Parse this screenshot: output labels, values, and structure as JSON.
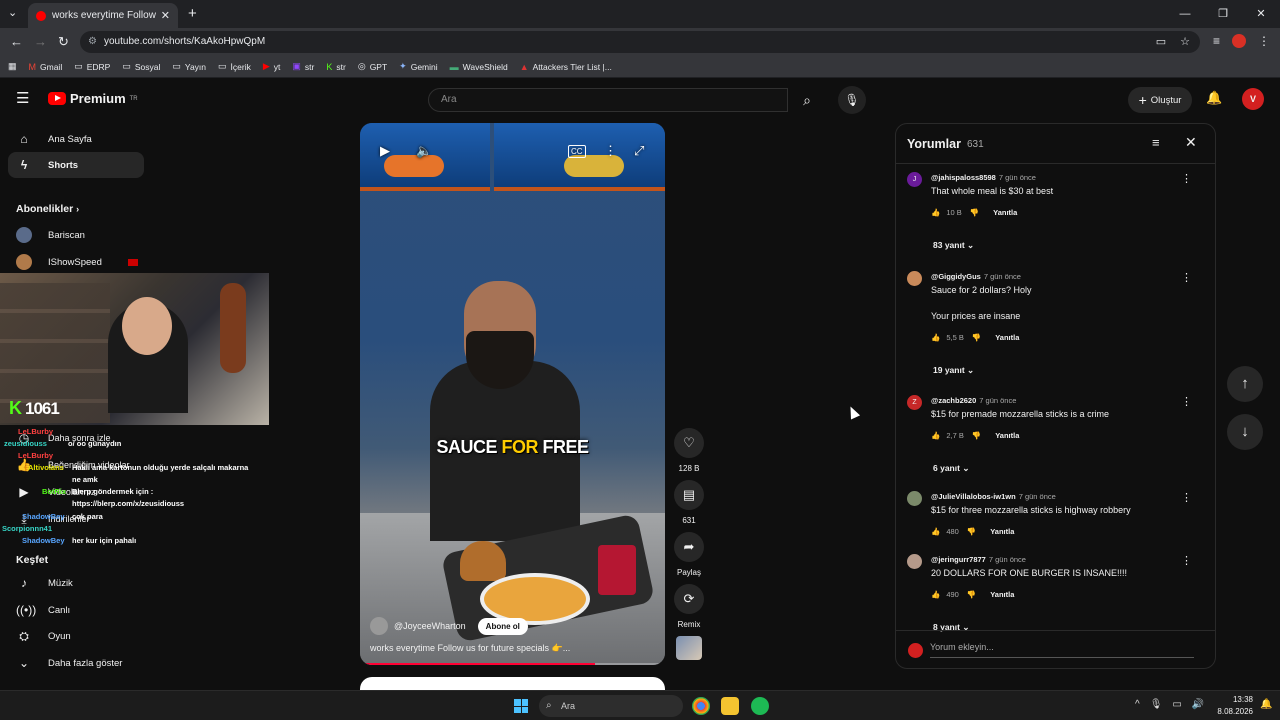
{
  "browser": {
    "tab_title": "works everytime Follow us for fu",
    "url": "youtube.com/shorts/KaAkoHpwQpM",
    "bookmarks": [
      "Gmail",
      "EDRP",
      "Sosyal",
      "Yayın",
      "İçerik",
      "yt",
      "str",
      "str",
      "GPT",
      "Gemini",
      "WaveShield",
      "Attackers Tier List |..."
    ]
  },
  "header": {
    "logo": "Premium",
    "region": "TR",
    "search_placeholder": "Ara",
    "create_label": "Oluştur"
  },
  "sidebar": {
    "items": [
      {
        "label": "Ana Sayfa",
        "icon": "home-icon"
      },
      {
        "label": "Shorts",
        "icon": "shorts-icon"
      }
    ],
    "subscriptions_heading": "Abonelikler",
    "channels": [
      "Bariscan",
      "IShowSpeed"
    ],
    "watch_later": "Daha sonra izle",
    "liked": "Beğendiğim videolar",
    "yours": "Videolarınız",
    "more": "İndirilenler",
    "explore_heading": "Keşfet",
    "explore": [
      {
        "label": "Müzik",
        "icon": "music-icon"
      },
      {
        "label": "Canlı",
        "icon": "live-icon"
      },
      {
        "label": "Oyun",
        "icon": "gaming-icon"
      },
      {
        "label": "Daha fazla göster",
        "icon": "chevron-down-icon"
      }
    ]
  },
  "overlay": {
    "kick_count": "1061",
    "chat": [
      {
        "user": "LeLBurby",
        "text": ""
      },
      {
        "user": "zeusidiouss",
        "text": "o/ oo günaydın"
      },
      {
        "user": "LeLBurby",
        "text": ""
      },
      {
        "user": "Altivolans",
        "text": "Hakli ama kartonun olduğu yerde salçalı makarna"
      },
      {
        "user": "",
        "text": "ne amk"
      },
      {
        "user": "BotRix",
        "text": "Blerp göndermek için :"
      },
      {
        "user": "",
        "text": "https://blerp.com/x/zeusidiouss"
      },
      {
        "user": "ShadowBey",
        "text": "çok para"
      },
      {
        "user": "Scorpionnn41",
        "text": ""
      },
      {
        "user": "ShadowBey",
        "text": "her kur için pahalı"
      }
    ]
  },
  "video": {
    "caption_white": "SAUCE ",
    "caption_yellow": "FOR",
    "caption_white2": " FREE",
    "channel": "@JoyceeWharton",
    "subscribe": "Abone ol",
    "title": "works everytime Follow us for future specials 👉...",
    "progress": 0.77
  },
  "actions": {
    "likes": "128 B",
    "comments": "631",
    "share": "Paylaş",
    "remix": "Remix"
  },
  "comments": {
    "title": "Yorumlar",
    "count": "631",
    "add_placeholder": "Yorum ekleyin...",
    "reply_label": "Yanıtla",
    "items": [
      {
        "user": "@jahispaloss8598",
        "time": "7 gün önce",
        "text": "That whole meal is $30 at best",
        "text2": "",
        "likes": "10 B",
        "replies": "83 yanıt",
        "avatar": "J",
        "color": "#6a1b9a"
      },
      {
        "user": "@GiggidyGus",
        "time": "7 gün önce",
        "text": "Sauce for 2 dollars? Holy",
        "text2": "Your prices are insane",
        "likes": "5,5 B",
        "replies": "19 yanıt",
        "avatar": "",
        "color": "#c98a5a"
      },
      {
        "user": "@zachb2620",
        "time": "7 gün önce",
        "text": "$15 for premade mozzarella sticks is a crime",
        "text2": "",
        "likes": "2,7 B",
        "replies": "6 yanıt",
        "avatar": "Z",
        "color": "#c62828"
      },
      {
        "user": "@JulieVillalobos-iw1wn",
        "time": "7 gün önce",
        "text": "$15 for three mozzarella sticks is highway robbery",
        "text2": "",
        "likes": "480",
        "replies": "",
        "avatar": "",
        "color": "#7b8a6a"
      },
      {
        "user": "@jeringurr7877",
        "time": "7 gün önce",
        "text": "20 DOLLARS FOR ONE BURGER IS INSANE!!!!",
        "text2": "",
        "likes": "490",
        "replies": "8 yanıt",
        "avatar": "",
        "color": "#b59a8a"
      }
    ]
  },
  "taskbar": {
    "search": "Ara",
    "time": "13:38",
    "date": "8.08.2026"
  }
}
